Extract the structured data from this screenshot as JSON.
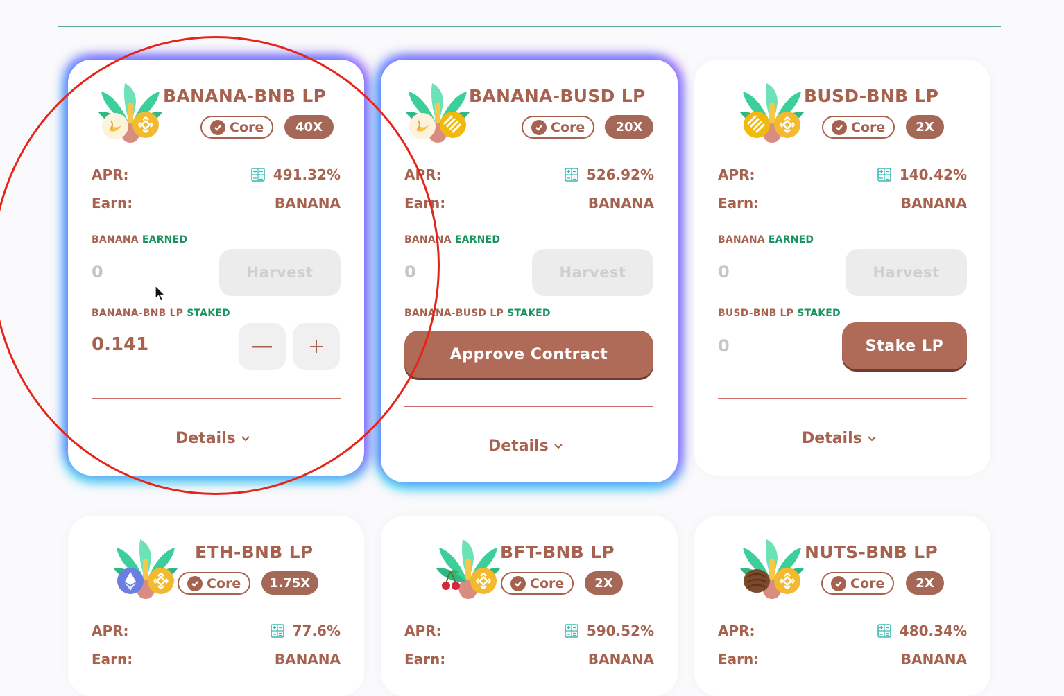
{
  "labels": {
    "apr": "APR:",
    "earn": "Earn:",
    "banana_word": "BANANA",
    "earned_word": "EARNED",
    "staked_word": "STAKED",
    "harvest": "Harvest",
    "details": "Details",
    "core": "Core"
  },
  "icons": {
    "calculator": "calculator-icon",
    "verified": "verified-check-icon",
    "chevron": "chevron-down-icon",
    "minus": "minus-icon",
    "plus": "plus-icon"
  },
  "colors": {
    "brand_brown": "#a7624f",
    "earned_green": "#18935f",
    "annotation_red": "#e5241a"
  },
  "farms": [
    {
      "name": "BANANA-BNB LP",
      "multiplier": "40X",
      "apr": "491.32%",
      "earn": "BANANA",
      "earned": "0",
      "staked_label": "BANANA-BNB LP",
      "staked": "0.141",
      "action": "",
      "token_a": "banana-token-icon",
      "token_b": "bnb-token-icon"
    },
    {
      "name": "BANANA-BUSD LP",
      "multiplier": "20X",
      "apr": "526.92%",
      "earn": "BANANA",
      "earned": "0",
      "staked_label": "BANANA-BUSD LP",
      "staked": "",
      "action": "Approve Contract",
      "token_a": "banana-token-icon",
      "token_b": "busd-token-icon"
    },
    {
      "name": "BUSD-BNB LP",
      "multiplier": "2X",
      "apr": "140.42%",
      "earn": "BANANA",
      "earned": "0",
      "staked_label": "BUSD-BNB LP",
      "staked": "0",
      "action": "Stake LP",
      "token_a": "busd-token-icon",
      "token_b": "bnb-token-icon"
    },
    {
      "name": "ETH-BNB LP",
      "multiplier": "1.75X",
      "apr": "77.6%",
      "earn": "BANANA",
      "token_a": "eth-token-icon",
      "token_b": "bnb-token-icon"
    },
    {
      "name": "BFT-BNB LP",
      "multiplier": "2X",
      "apr": "590.52%",
      "earn": "BANANA",
      "token_a": "cherry-token-icon",
      "token_b": "bnb-token-icon"
    },
    {
      "name": "NUTS-BNB LP",
      "multiplier": "2X",
      "apr": "480.34%",
      "earn": "BANANA",
      "token_a": "nuts-token-icon",
      "token_b": "bnb-token-icon"
    }
  ]
}
